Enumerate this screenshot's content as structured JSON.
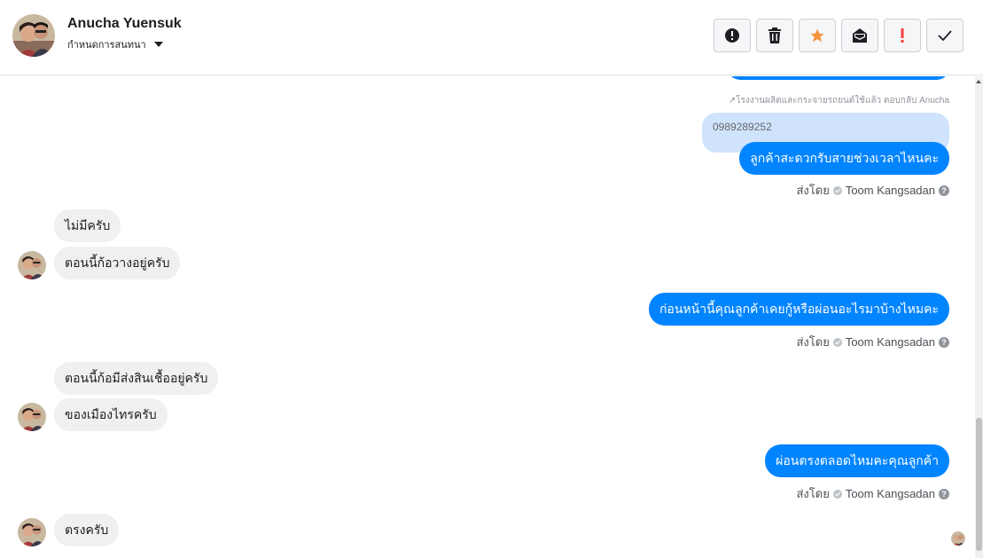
{
  "header": {
    "contact_name": "Anucha Yuensuk",
    "sub_action_label": "กำหนดการสนทนา"
  },
  "toolbar": {
    "buttons": [
      {
        "name": "spam-button",
        "icon": "alert-circle-icon",
        "color": "#1c1e21"
      },
      {
        "name": "delete-button",
        "icon": "trash-icon",
        "color": "#1c1e21"
      },
      {
        "name": "star-button",
        "icon": "star-icon",
        "color": "#f7923b"
      },
      {
        "name": "mark-unread-button",
        "icon": "envelope-icon",
        "color": "#1c1e21"
      },
      {
        "name": "follow-up-button",
        "icon": "exclamation-icon",
        "color": "#fa3e3e"
      },
      {
        "name": "mark-done-button",
        "icon": "checkmark-icon",
        "color": "#1c1e21"
      }
    ]
  },
  "thread": {
    "reply_note": "↗โรงงานผลิตและกระจายรถยนต์ใช้แล้ว ตอบกลับ Anucha",
    "reply_quote": "0989289252",
    "outgoing": [
      "ลูกค้าสะดวกรับสายช่วงเวลาไหนคะ",
      "ก่อนหน้านี้คุณลูกค้าเคยกู้หรือผ่อนอะไรมาบ้างไหมคะ",
      "ผ่อนตรงตลอดไหมคะคุณลูกค้า"
    ],
    "sent_by_label": "ส่งโดย",
    "sender_name": "Toom Kangsadan",
    "incoming": [
      "ไม่มีครับ",
      "ตอนนี้ก้อวางอยู่ครับ",
      "ตอนนี้ก้อมีส่งสินเชื้ออยู่ครับ",
      "ของเมืองไทรครับ",
      "ตรงครับ"
    ]
  },
  "colors": {
    "outgoing_bubble": "#0084ff",
    "incoming_bubble": "#f1f0f0",
    "reply_bubble": "#cfe4fc",
    "star": "#f7923b",
    "alert": "#fa3e3e"
  }
}
